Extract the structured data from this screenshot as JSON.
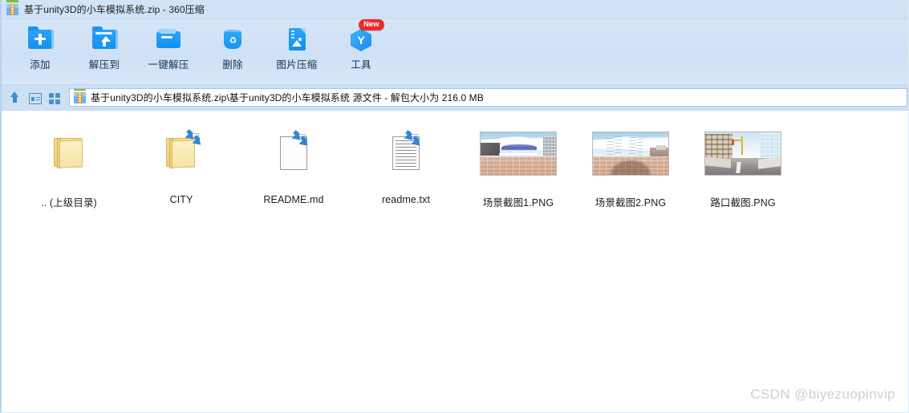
{
  "window": {
    "title": "基于unity3D的小车模拟系统.zip - 360压缩",
    "icon": "zip-archive-icon"
  },
  "toolbar": {
    "buttons": [
      {
        "label": "添加",
        "icon": "folder-add-icon",
        "badge": null
      },
      {
        "label": "解压到",
        "icon": "folder-extract-icon",
        "badge": null
      },
      {
        "label": "一键解压",
        "icon": "one-click-extract-icon",
        "badge": null
      },
      {
        "label": "删除",
        "icon": "recycle-bin-icon",
        "badge": null
      },
      {
        "label": "图片压缩",
        "icon": "image-compress-icon",
        "badge": null
      },
      {
        "label": "工具",
        "icon": "tools-hexagon-icon",
        "badge": "New"
      }
    ]
  },
  "addressbar": {
    "nav": [
      {
        "icon": "up-arrow-icon",
        "name": "navigate-up"
      },
      {
        "icon": "details-view-icon",
        "name": "details-view"
      },
      {
        "icon": "grid-view-icon",
        "name": "grid-view"
      }
    ],
    "path_icon": "zip-archive-icon",
    "path": "基于unity3D的小车模拟系统.zip\\基于unity3D的小车模拟系统 源文件 - 解包大小为 216.0 MB"
  },
  "files": [
    {
      "name": ".. (上级目录)",
      "type": "parent-folder",
      "icon": "folder-icon",
      "compressed": false
    },
    {
      "name": "CITY",
      "type": "folder",
      "icon": "folder-icon",
      "compressed": true
    },
    {
      "name": "README.md",
      "type": "file",
      "icon": "blank-document-icon",
      "compressed": true
    },
    {
      "name": "readme.txt",
      "type": "file",
      "icon": "text-document-icon",
      "compressed": true
    },
    {
      "name": "场景截图1.PNG",
      "type": "image",
      "icon": "image-thumbnail",
      "compressed": true
    },
    {
      "name": "场景截图2.PNG",
      "type": "image",
      "icon": "image-thumbnail",
      "compressed": true
    },
    {
      "name": "路口截图.PNG",
      "type": "image",
      "icon": "image-thumbnail",
      "compressed": true
    }
  ],
  "watermark": "CSDN @biyezuopinvip",
  "colors": {
    "chrome_blue": "#cfe0f5",
    "accent_blue": "#1a96f2",
    "badge_red": "#ee2b2b",
    "folder_yellow": "#f6dd92",
    "watermark_gray": "#cfcfcf"
  }
}
